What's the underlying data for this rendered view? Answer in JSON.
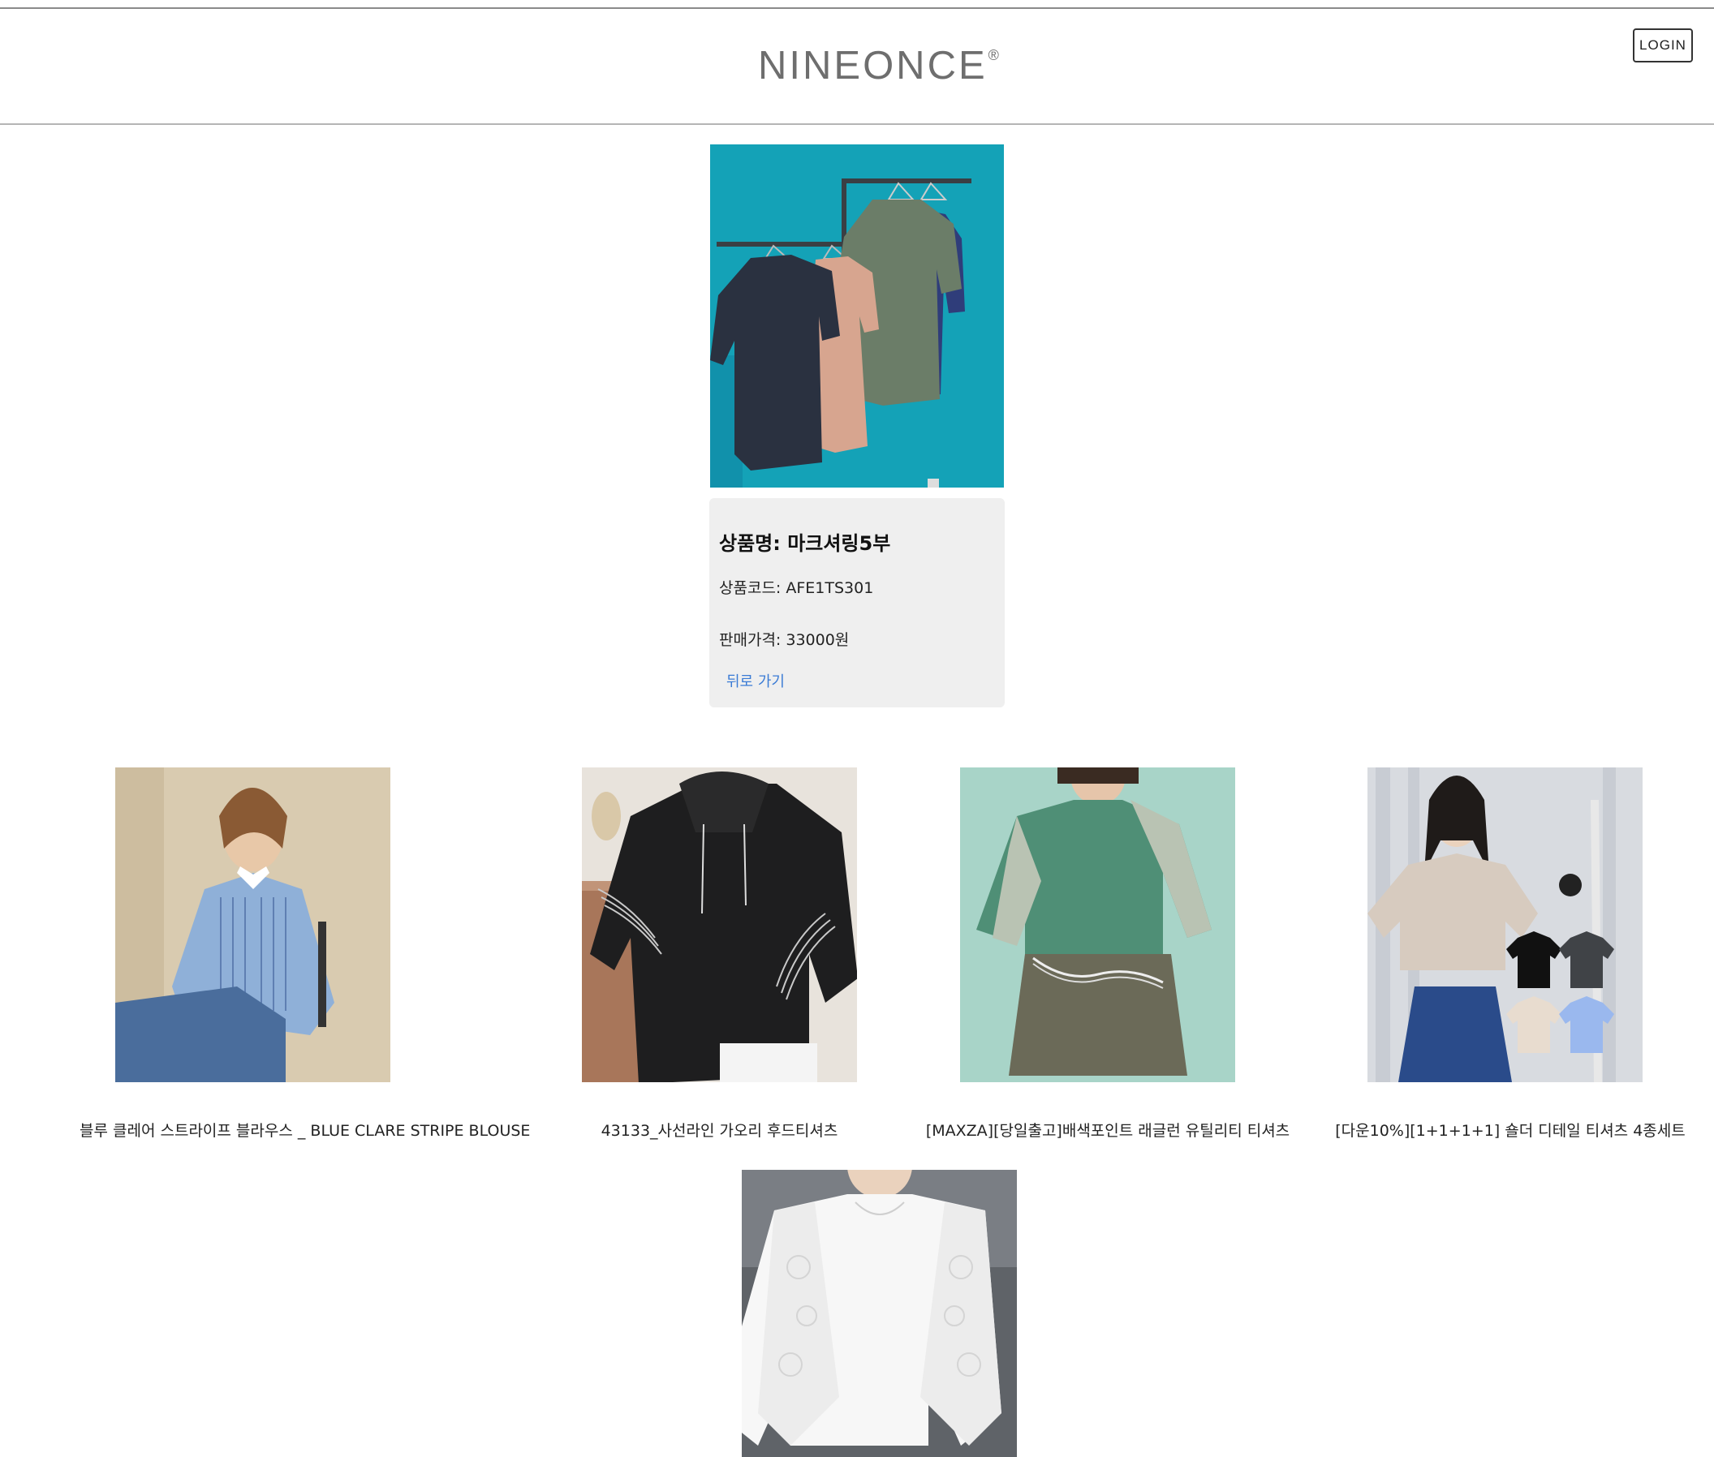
{
  "header": {
    "logo_text": "NINEONCE",
    "logo_mark": "®",
    "login_label": "LOGIN"
  },
  "product": {
    "image_icon": "clothes-on-rack-photo",
    "name_line": "상품명: 마크셔링5부",
    "code_line": "상품코드: AFE1TS301",
    "price_line": "판매가격: 33000원",
    "back_label": "뒤로 가기"
  },
  "related": [
    {
      "name": "블루 클레어 스트라이프 블라우스 _ BLUE CLARE STRIPE BLOUSE",
      "image_icon": "striped-blouse-photo"
    },
    {
      "name": "43133_사선라인 가오리 후드티셔츠",
      "image_icon": "black-hoodie-photo"
    },
    {
      "name": "[MAXZA][당일출고]배색포인트 래글런 유틸리티 티셔츠",
      "image_icon": "green-raglan-tee-photo"
    },
    {
      "name": "[다운10%][1+1+1+1] 숄더 디테일 티셔츠 4종세트",
      "image_icon": "tee-set-photo"
    },
    {
      "name": "",
      "image_icon": "white-lace-sleeve-top-photo"
    }
  ],
  "colors": {
    "link": "#3a7bd5",
    "card_bg": "#efefef",
    "logo": "#6e6e6e"
  }
}
